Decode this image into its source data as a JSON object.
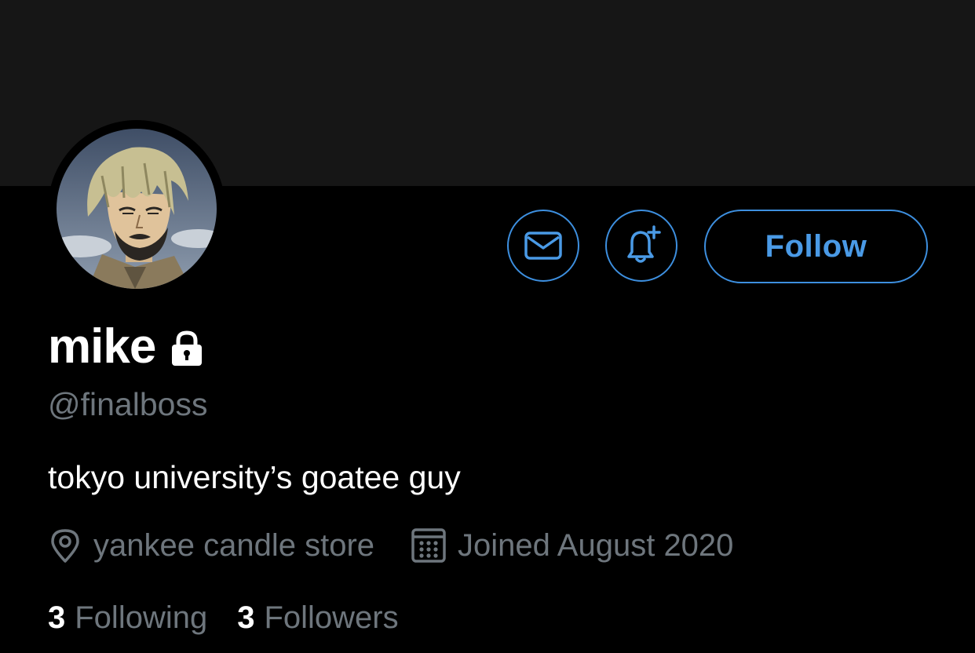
{
  "profile": {
    "display_name": "mike",
    "handle": "@finalboss",
    "bio": "tokyo university’s goatee guy",
    "location": "yankee candle store",
    "joined": "Joined August 2020",
    "following_count": "3",
    "following_label": "Following",
    "followers_count": "3",
    "followers_label": "Followers",
    "protected_icon": "lock-icon"
  },
  "actions": {
    "follow_label": "Follow",
    "message_icon": "envelope-icon",
    "notify_icon": "bell-plus-icon"
  },
  "colors": {
    "background": "#000000",
    "banner": "#161616",
    "accent": "#3d8fdf",
    "secondary_text": "#6e767d",
    "primary_text": "#ffffff"
  }
}
